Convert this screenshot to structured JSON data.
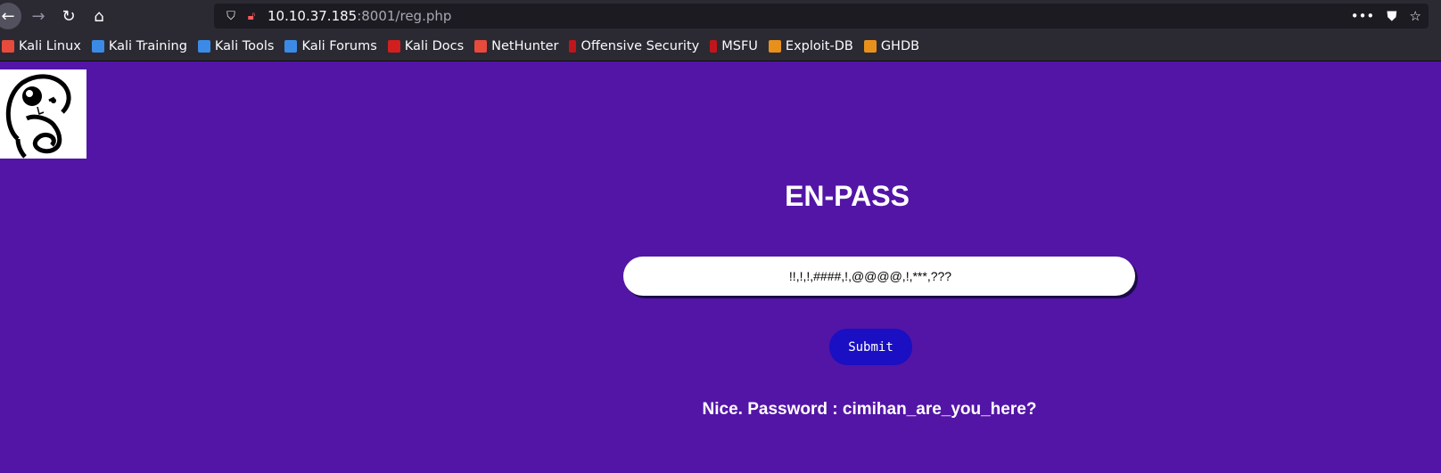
{
  "browser": {
    "url_host": "10.10.37.185",
    "url_path": ":8001/reg.php"
  },
  "bookmarks": [
    {
      "label": "Kali Linux",
      "color": "#e84a3c"
    },
    {
      "label": "Kali Training",
      "color": "#3b8be6"
    },
    {
      "label": "Kali Tools",
      "color": "#3b8be6"
    },
    {
      "label": "Kali Forums",
      "color": "#3b8be6"
    },
    {
      "label": "Kali Docs",
      "color": "#d11f1f"
    },
    {
      "label": "NetHunter",
      "color": "#e84a3c"
    },
    {
      "label": "Offensive Security",
      "color": "#c0161b"
    },
    {
      "label": "MSFU",
      "color": "#c0161b"
    },
    {
      "label": "Exploit-DB",
      "color": "#e8901c"
    },
    {
      "label": "GHDB",
      "color": "#e8901c"
    }
  ],
  "page": {
    "title": "EN-PASS",
    "input_value": "!!,!,!,####,!,@@@@,!,***,???",
    "submit_label": "Submit",
    "result": "Nice. Password : cimihan_are_you_here?",
    "background_color": "#5315a6"
  }
}
